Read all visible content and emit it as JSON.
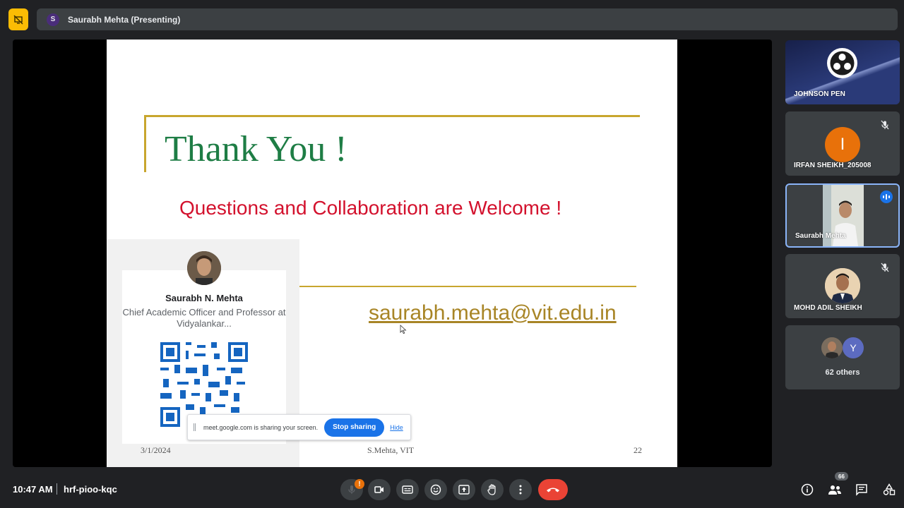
{
  "topbar": {
    "presenter_initial": "S",
    "presenter_label": "Saurabh Mehta (Presenting)"
  },
  "slide": {
    "title": "Thank You !",
    "subtitle": "Questions and Collaboration are Welcome !",
    "email": "saurabh.mehta@vit.edu.in",
    "card_name": "Saurabh N. Mehta",
    "card_role": "Chief Academic Officer and Professor at Vidyalankar...",
    "footer_date": "3/1/2024",
    "footer_center": "S.Mehta, VIT",
    "page_number": "22"
  },
  "share_notice": {
    "message": "meet.google.com is sharing your screen.",
    "stop_label": "Stop sharing",
    "hide_label": "Hide"
  },
  "participants": [
    {
      "name": "JOHNSON PEN",
      "muted": false
    },
    {
      "name": "IRFAN SHEIKH_205008",
      "initial": "I",
      "avatar_color": "#e8710a",
      "muted": true
    },
    {
      "name": "Saurabh Mehta",
      "speaking": true
    },
    {
      "name": "MOHD ADIL SHEIKH",
      "muted": true
    },
    {
      "initial": "Y",
      "label": "62 others"
    }
  ],
  "bottombar": {
    "time": "10:47 AM",
    "meeting_code": "hrf-pioo-kqc",
    "mic_warning": "!",
    "participant_count": "66"
  },
  "colors": {
    "accent": "#1a73e8",
    "hangup": "#ea4335",
    "title_green": "#1e7d45",
    "subtitle_red": "#d3112d",
    "gold": "#c8a62e"
  }
}
